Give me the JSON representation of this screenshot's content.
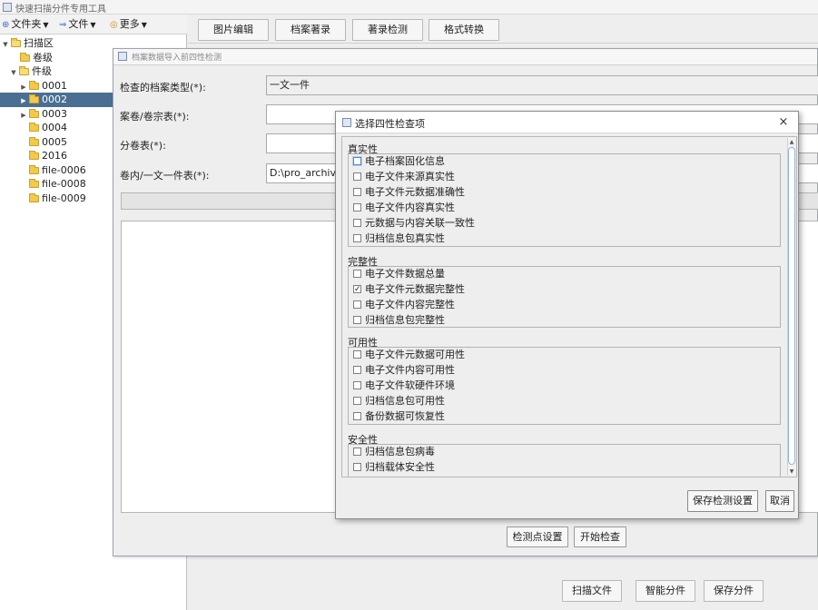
{
  "app": {
    "title": "快速扫描分件专用工具"
  },
  "left_toolbar": {
    "folder_menu": "文件夹",
    "file_menu": "文件",
    "more_menu": "更多"
  },
  "tree": {
    "root": "扫描区",
    "volume_level": "卷级",
    "item_level": "件级",
    "items": [
      "0001",
      "0002",
      "0003",
      "0004",
      "0005",
      "2016",
      "file-0006",
      "file-0008",
      "file-0009"
    ],
    "selected": "0002"
  },
  "tabs": [
    "图片编辑",
    "档案著录",
    "著录检测",
    "格式转换"
  ],
  "bottom_buttons": {
    "scan": "扫描文件",
    "smart_split": "智能分件",
    "save_split": "保存分件"
  },
  "inner_frame": {
    "title": "档案数据导入前四性检测",
    "fields": {
      "type_label": "检查的档案类型(*):",
      "type_value": "一文一件",
      "roll_label": "案卷/卷宗表(*):",
      "roll_value": "",
      "subroll_label": "分卷表(*):",
      "subroll_value": "",
      "doc_label": "卷内/一文一件表(*):",
      "doc_value": "D:\\pro_archive_c"
    },
    "buttons": {
      "checkpoint": "检测点设置",
      "start": "开始检查"
    }
  },
  "dialog": {
    "title": "选择四性检查项",
    "close": "×",
    "groups": [
      {
        "title": "真实性",
        "items": [
          {
            "label": "电子档案固化信息",
            "checked": false,
            "focused": true
          },
          {
            "label": "电子文件来源真实性",
            "checked": false
          },
          {
            "label": "电子文件元数据准确性",
            "checked": false
          },
          {
            "label": "电子文件内容真实性",
            "checked": false
          },
          {
            "label": "元数据与内容关联一致性",
            "checked": false
          },
          {
            "label": "归档信息包真实性",
            "checked": false
          }
        ]
      },
      {
        "title": "完整性",
        "items": [
          {
            "label": "电子文件数据总量",
            "checked": false
          },
          {
            "label": "电子文件元数据完整性",
            "checked": true
          },
          {
            "label": "电子文件内容完整性",
            "checked": false
          },
          {
            "label": "归档信息包完整性",
            "checked": false
          }
        ]
      },
      {
        "title": "可用性",
        "items": [
          {
            "label": "电子文件元数据可用性",
            "checked": false
          },
          {
            "label": "电子文件内容可用性",
            "checked": false
          },
          {
            "label": "电子文件软硬件环境",
            "checked": false
          },
          {
            "label": "归档信息包可用性",
            "checked": false
          },
          {
            "label": "备份数据可恢复性",
            "checked": false
          }
        ]
      },
      {
        "title": "安全性",
        "items": [
          {
            "label": "归档信息包病毒",
            "checked": false
          },
          {
            "label": "归档载体安全性",
            "checked": false
          }
        ]
      }
    ],
    "buttons": {
      "save": "保存检测设置",
      "cancel": "取消"
    }
  }
}
